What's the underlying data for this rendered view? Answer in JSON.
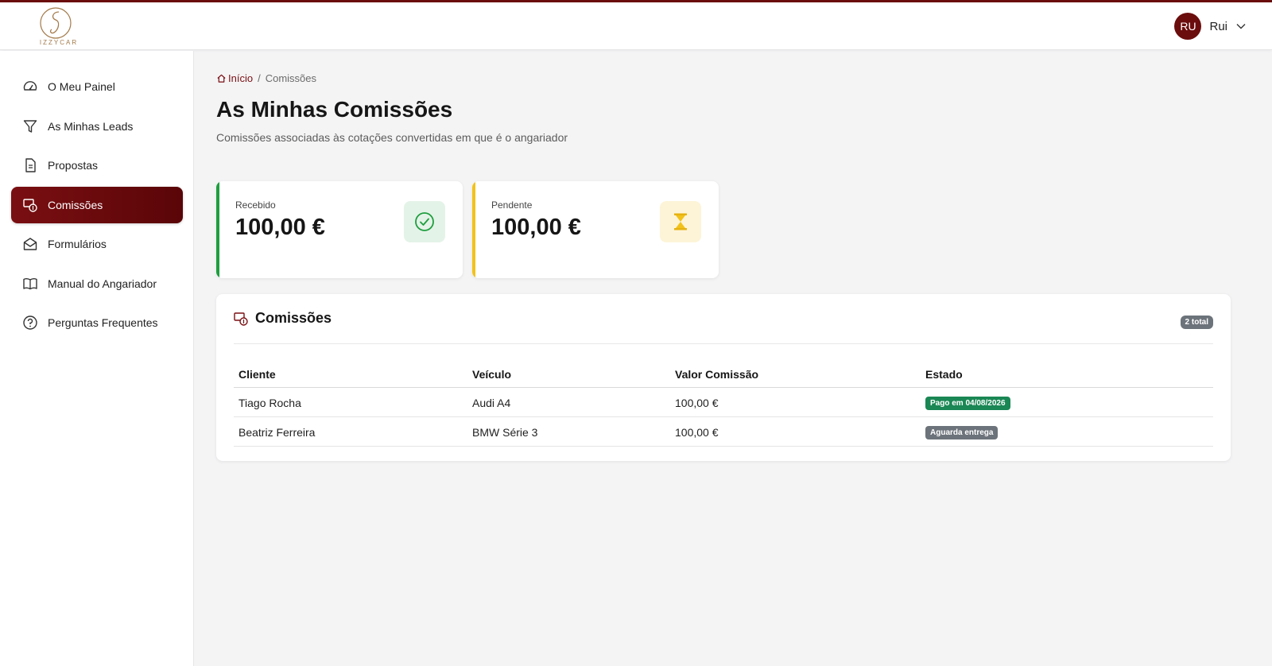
{
  "brand": {
    "logo_text": "IZZYCAR",
    "accent": "#6b0d0d"
  },
  "user": {
    "initials": "RU",
    "name": "Rui"
  },
  "sidebar": {
    "items": [
      {
        "label": "O Meu Painel",
        "icon": "dashboard-gauge-icon"
      },
      {
        "label": "As Minhas Leads",
        "icon": "funnel-icon"
      },
      {
        "label": "Propostas",
        "icon": "document-icon"
      },
      {
        "label": "Comissões",
        "icon": "commission-icon",
        "active": true
      },
      {
        "label": "Formulários",
        "icon": "envelope-icon"
      },
      {
        "label": "Manual do Angariador",
        "icon": "book-icon"
      },
      {
        "label": "Perguntas Frequentes",
        "icon": "question-circle-icon"
      }
    ]
  },
  "breadcrumb": {
    "home": "Início",
    "separator": "/",
    "current": "Comissões"
  },
  "page": {
    "title": "As Minhas Comissões",
    "subtitle": "Comissões associadas às cotações convertidas em que é o angariador"
  },
  "stats": {
    "received": {
      "label": "Recebido",
      "value": "100,00 €",
      "color": "#1e9e3e",
      "icon": "check-circle-icon"
    },
    "pending": {
      "label": "Pendente",
      "value": "100,00 €",
      "color": "#f2c21b",
      "icon": "hourglass-icon"
    }
  },
  "commissions": {
    "title": "Comissões",
    "total_badge": "2 total",
    "columns": [
      "Cliente",
      "Veículo",
      "Valor Comissão",
      "Estado"
    ],
    "rows": [
      {
        "client": "Tiago Rocha",
        "vehicle": "Audi A4",
        "value": "100,00 €",
        "status": "Pago em 04/08/2026",
        "status_color": "#1a8754"
      },
      {
        "client": "Beatriz Ferreira",
        "vehicle": "BMW Série 3",
        "value": "100,00 €",
        "status": "Aguarda entrega",
        "status_color": "#6c737a"
      }
    ]
  }
}
